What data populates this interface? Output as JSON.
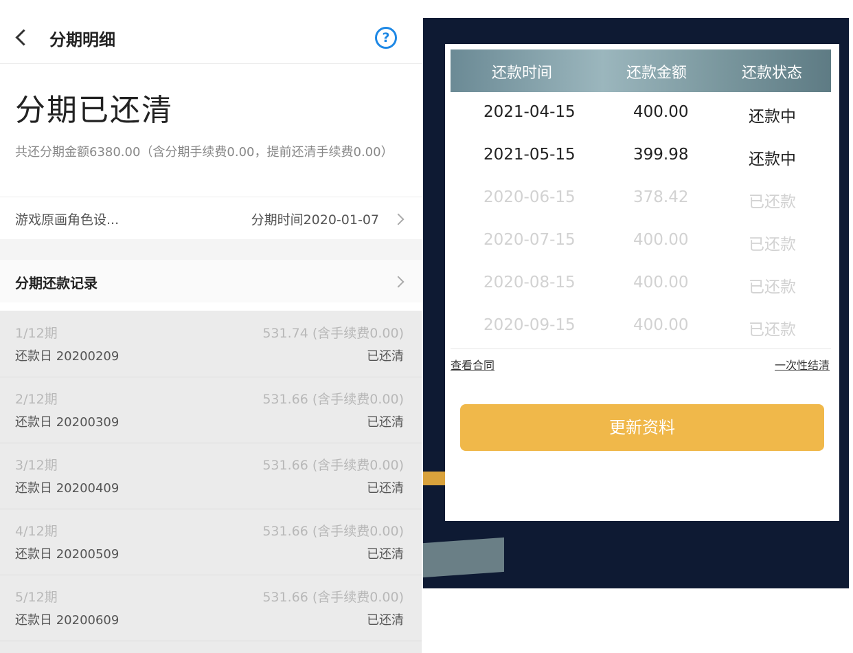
{
  "left": {
    "topbar": {
      "title": "分期明细",
      "help_glyph": "?"
    },
    "headline": "分期已还清",
    "summary": "共还分期金额6380.00（含分期手续费0.00，提前还清手续费0.00）",
    "game": {
      "name": "游戏原画角色设...",
      "date": "分期时间2020-01-07"
    },
    "records_label": "分期还款记录",
    "installments": [
      {
        "period": "1/12期",
        "amount": "531.74 (含手续费0.00)",
        "due": "还款日 20200209",
        "status": "已还清"
      },
      {
        "period": "2/12期",
        "amount": "531.66 (含手续费0.00)",
        "due": "还款日 20200309",
        "status": "已还清"
      },
      {
        "period": "3/12期",
        "amount": "531.66 (含手续费0.00)",
        "due": "还款日 20200409",
        "status": "已还清"
      },
      {
        "period": "4/12期",
        "amount": "531.66 (含手续费0.00)",
        "due": "还款日 20200509",
        "status": "已还清"
      },
      {
        "period": "5/12期",
        "amount": "531.66 (含手续费0.00)",
        "due": "还款日 20200609",
        "status": "已还清"
      }
    ]
  },
  "right": {
    "headers": {
      "time": "还款时间",
      "amount": "还款金额",
      "status": "还款状态"
    },
    "rows": [
      {
        "date": "2021-04-15",
        "amount": "400.00",
        "status": "还款中"
      },
      {
        "date": "2021-05-15",
        "amount": "399.98",
        "status": "还款中"
      },
      {
        "date": "2020-06-15",
        "amount": "378.42",
        "status": "已还款"
      },
      {
        "date": "2020-07-15",
        "amount": "400.00",
        "status": "已还款"
      },
      {
        "date": "2020-08-15",
        "amount": "400.00",
        "status": "已还款"
      },
      {
        "date": "2020-09-15",
        "amount": "400.00",
        "status": "已还款"
      }
    ],
    "view_contract": "查看合同",
    "pay_off": "一次性结清",
    "update_button": "更新资料"
  },
  "colors": {
    "help_blue": "#1e88e5",
    "button_orange": "#f0b84a",
    "bg_navy": "#0e1a33"
  }
}
